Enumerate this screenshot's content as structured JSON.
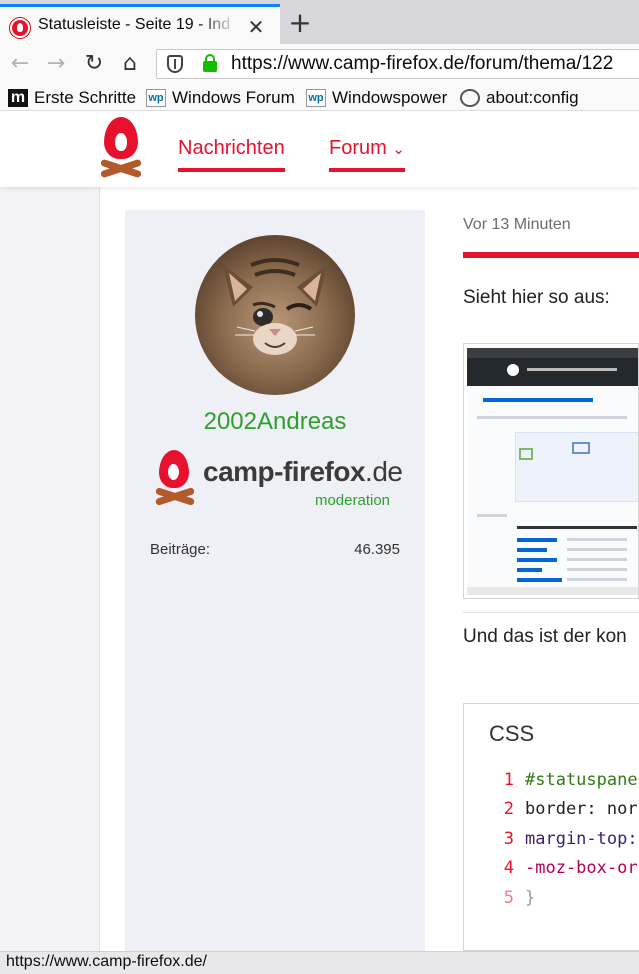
{
  "browser": {
    "tab_title": "Statusleiste - Seite 19 - Ind",
    "tab_close": "✕",
    "new_tab": "+",
    "nav": {
      "back": "←",
      "forward": "→",
      "reload": "↻",
      "home": "⌂"
    },
    "url": "https://www.camp-firefox.de/forum/thema/122",
    "bookmarks": [
      {
        "label": "Erste Schritte",
        "icon": "m"
      },
      {
        "label": "Windows Forum",
        "icon": "wp"
      },
      {
        "label": "Windowspower",
        "icon": "wp"
      },
      {
        "label": "about:config",
        "icon": "globe"
      }
    ],
    "status_url": "https://www.camp-firefox.de/"
  },
  "site": {
    "nav": [
      {
        "label": "Nachrichten"
      },
      {
        "label": "Forum",
        "chevron": "⌄"
      }
    ],
    "accent_color": "#e8112d"
  },
  "user": {
    "name": "2002Andreas",
    "brand_name": "camp-firefox",
    "brand_tld": ".de",
    "brand_sub": "moderation",
    "stat_label": "Beiträge:",
    "stat_value": "46.395",
    "name_color": "#2ca02c"
  },
  "post": {
    "time": "Vor 13 Minuten",
    "text1": "Sieht hier so aus:",
    "text2": "Und das ist der kon",
    "code": {
      "title": "CSS",
      "lines": [
        {
          "num": "1",
          "text": "#statuspane"
        },
        {
          "num": "2",
          "text": "border: nor"
        },
        {
          "num": "3",
          "text": "margin-top:"
        },
        {
          "num": "4",
          "text": "-moz-box-or"
        },
        {
          "num": "5",
          "text": "}"
        }
      ]
    }
  }
}
